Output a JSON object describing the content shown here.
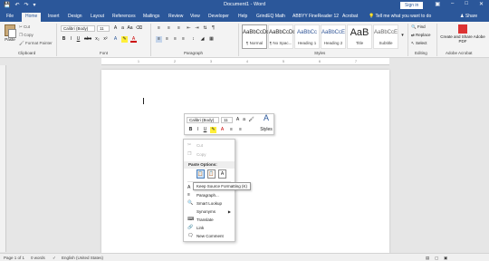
{
  "titlebar": {
    "title": "Document1 - Word",
    "signin": "Sign in",
    "qat": [
      "save-icon",
      "undo-icon",
      "redo-icon",
      "customize-icon"
    ],
    "controls": [
      "ribbon-display-icon",
      "minimize-icon",
      "maximize-icon",
      "close-icon"
    ]
  },
  "tabs": {
    "file": "File",
    "items": [
      "Home",
      "Insert",
      "Design",
      "Layout",
      "References",
      "Mailings",
      "Review",
      "View",
      "Developer",
      "Help",
      "GrindEQ Math",
      "ABBYY FineReader 12",
      "Acrobat"
    ],
    "tellme": "Tell me what you want to do",
    "share": "Share"
  },
  "ribbon": {
    "clipboard": {
      "paste": "Paste",
      "cut": "Cut",
      "copy": "Copy",
      "format_painter": "Format Painter",
      "label": "Clipboard"
    },
    "font": {
      "name": "Calibri (Body)",
      "size": "11",
      "label": "Font",
      "buttons": [
        "B",
        "I",
        "U",
        "abc",
        "x₂",
        "x²",
        "A"
      ]
    },
    "paragraph": {
      "label": "Paragraph"
    },
    "styles": {
      "label": "Styles",
      "items": [
        {
          "preview": "AaBbCcDc",
          "name": "¶ Normal"
        },
        {
          "preview": "AaBbCcDc",
          "name": "¶ No Spac..."
        },
        {
          "preview": "AaBbCc",
          "name": "Heading 1"
        },
        {
          "preview": "AaBbCcE",
          "name": "Heading 2"
        },
        {
          "preview": "AaB",
          "name": "Title"
        },
        {
          "preview": "AaBbCcE",
          "name": "Subtitle"
        }
      ]
    },
    "editing": {
      "label": "Editing",
      "find": "Find",
      "replace": "Replace",
      "select": "Select"
    },
    "acrobat": {
      "label": "Adobe Acrobat",
      "button": "Create and Share Adobe PDF"
    }
  },
  "mini_toolbar": {
    "font": "Calibri (Body)",
    "size": "11",
    "styles": "Styles"
  },
  "context_menu": {
    "cut": "Cut",
    "copy": "Copy",
    "paste_options": "Paste Options:",
    "font": "Font...",
    "paragraph": "Paragraph...",
    "smart_lookup": "Smart Lookup",
    "synonyms": "Synonyms",
    "translate": "Translate",
    "link": "Link",
    "new_comment": "New Comment"
  },
  "tooltip": "Keep Source Formatting (K)",
  "statusbar": {
    "page": "Page 1 of 1",
    "words": "0 words",
    "language": "English (United States)"
  }
}
